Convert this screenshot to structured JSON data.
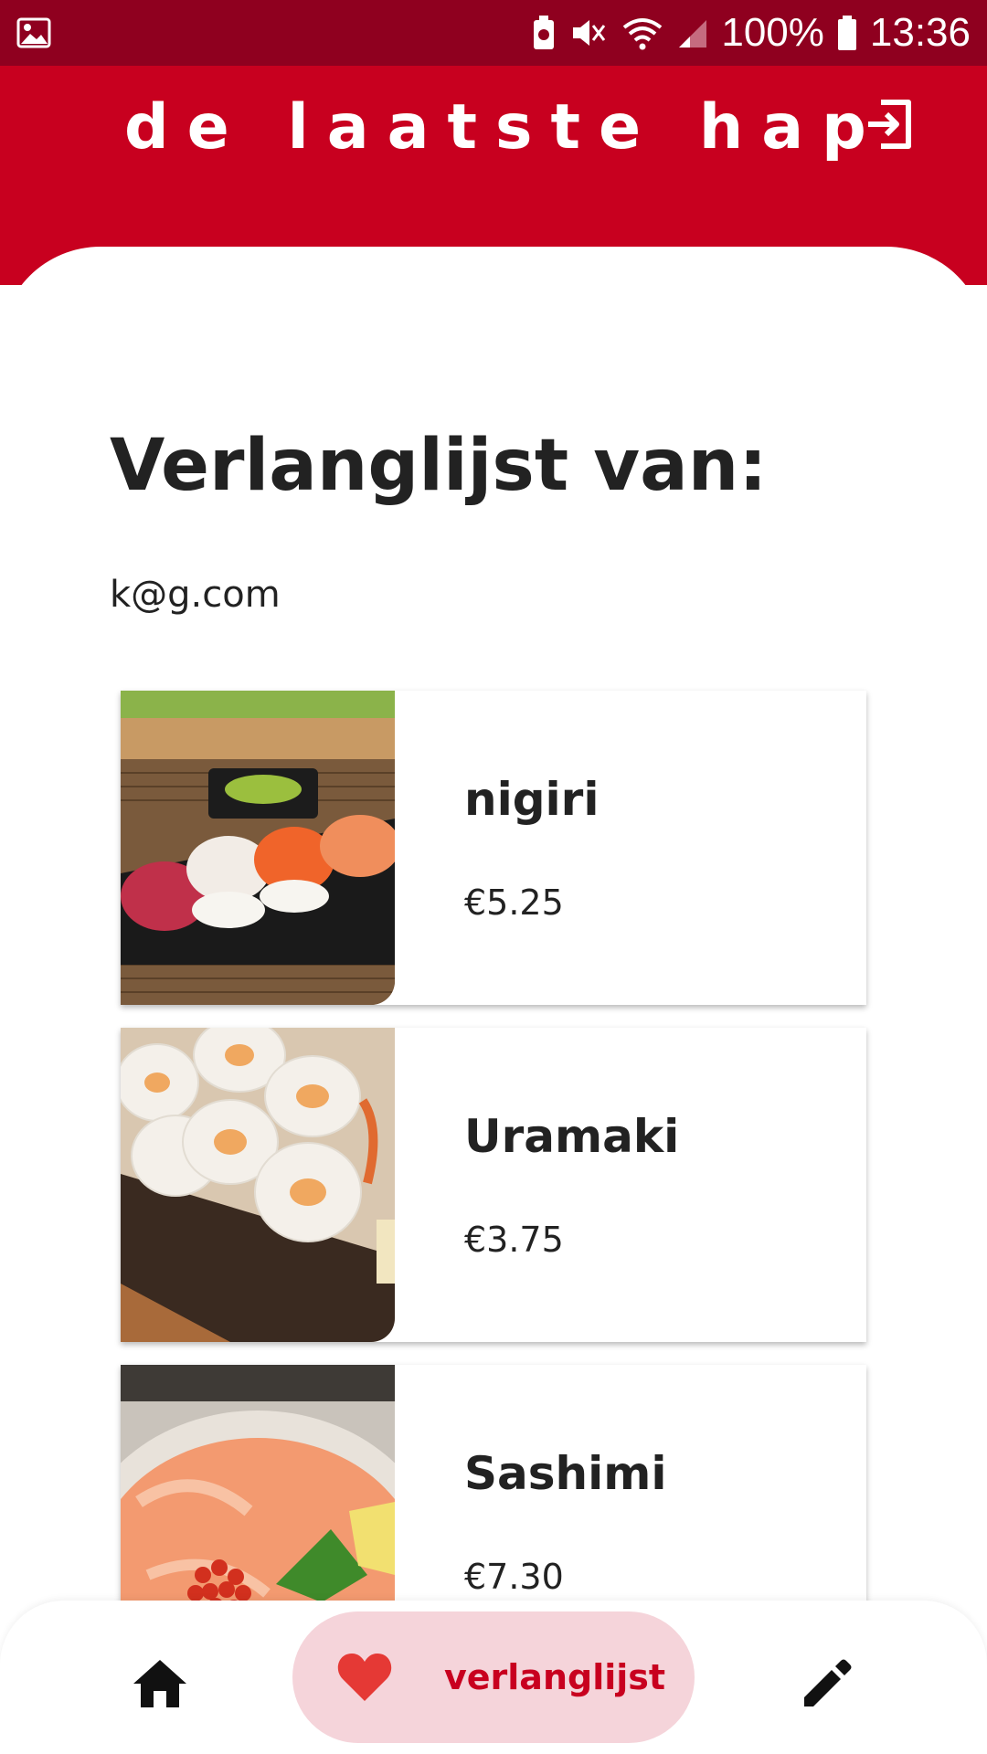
{
  "status_bar": {
    "battery": "100%",
    "time": "13:36",
    "icons": [
      "gallery-icon",
      "battery-saver-icon",
      "mute-icon",
      "wifi-icon",
      "signal-icon",
      "battery-icon"
    ]
  },
  "header": {
    "title": "de laatste hap",
    "logout_icon": "logout-icon"
  },
  "page": {
    "title": "Verlanglijst van:",
    "email": "k@g.com"
  },
  "wishlist": {
    "items": [
      {
        "name": "nigiri",
        "price": "€5.25",
        "image": "nigiri-photo"
      },
      {
        "name": "Uramaki",
        "price": "€3.75",
        "image": "uramaki-photo"
      },
      {
        "name": "Sashimi",
        "price": "€7.30",
        "image": "sashimi-photo"
      }
    ]
  },
  "bottom_nav": {
    "home_icon": "home-icon",
    "wishlist_label": "verlanglijst",
    "wishlist_icon": "heart-icon",
    "edit_icon": "pencil-icon",
    "active": "verlanglijst"
  },
  "colors": {
    "status_bar": "#8f001f",
    "header": "#c8001f",
    "accent": "#c8001f",
    "active_pill": "#f5d4da",
    "heart": "#e53935"
  }
}
